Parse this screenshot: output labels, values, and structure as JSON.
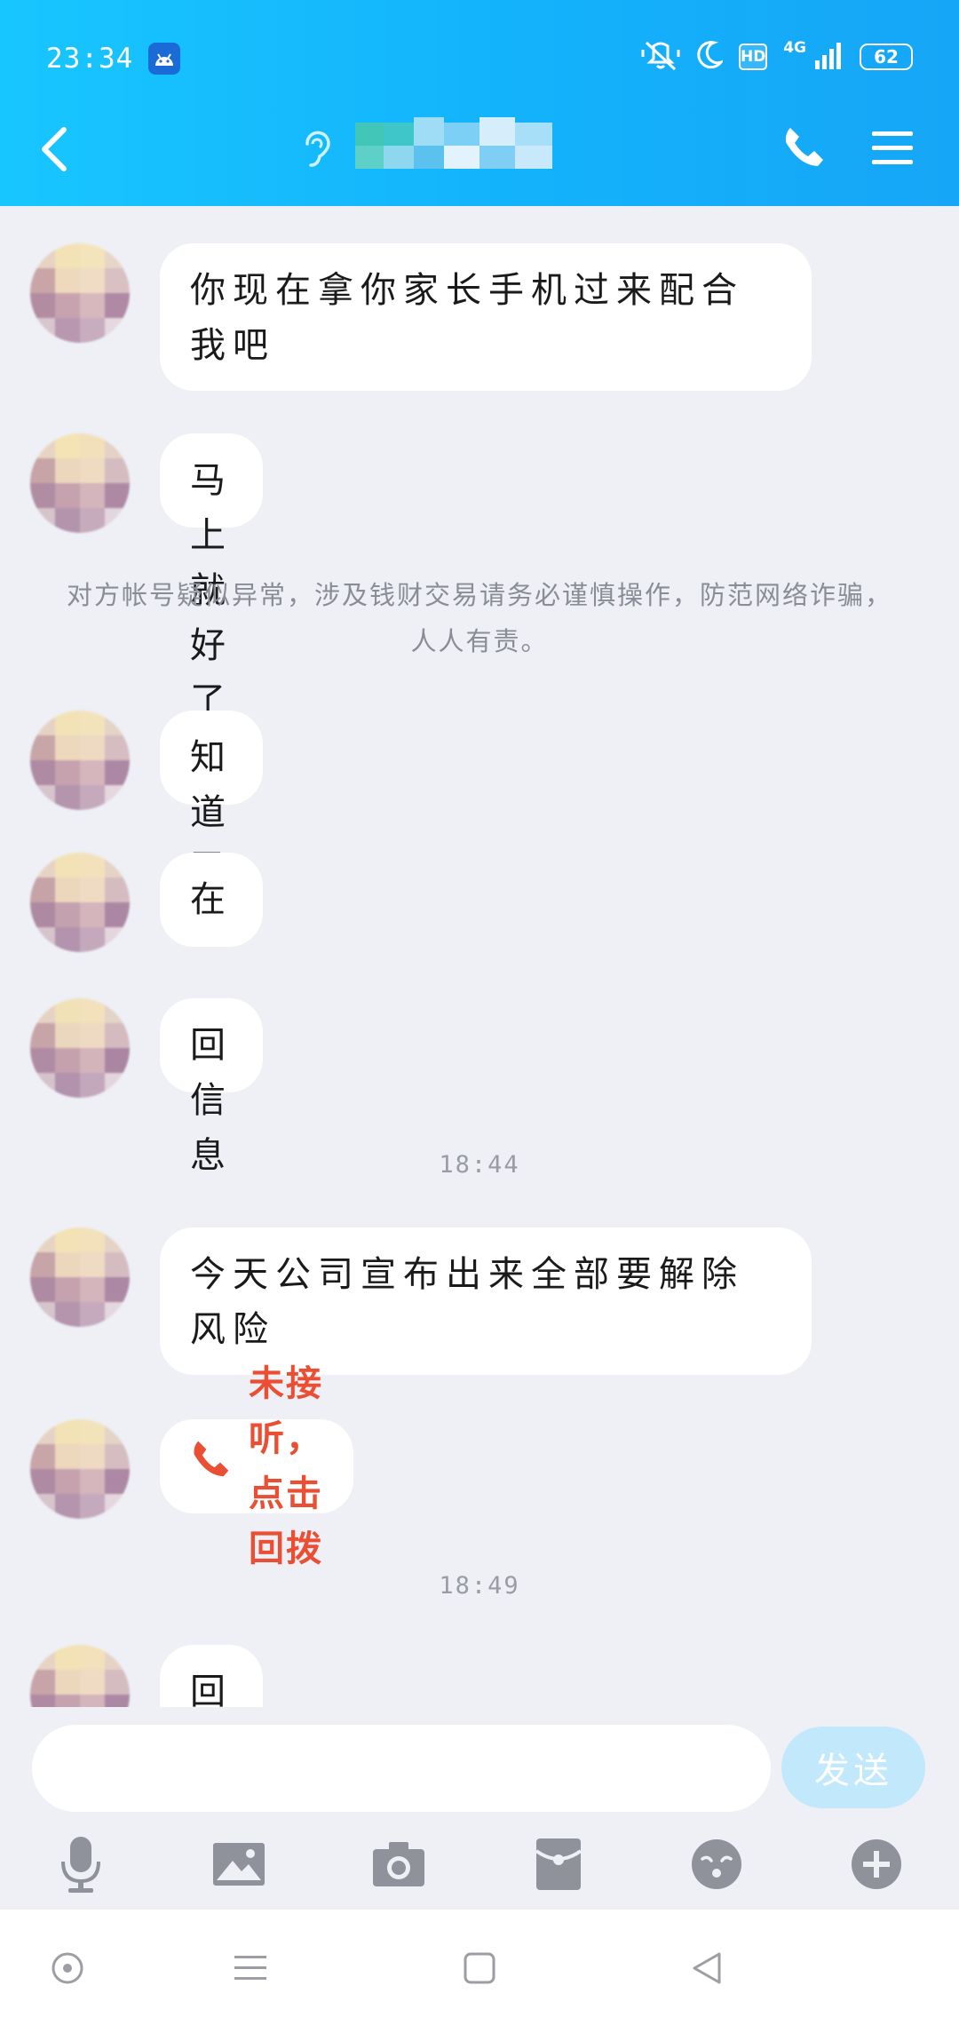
{
  "status_bar": {
    "time": "23:34",
    "network": "4G",
    "hd": "HD",
    "battery": "62"
  },
  "header": {
    "contact_name": ""
  },
  "messages": [
    {
      "type": "text",
      "text": "你现在拿你家长手机过来配合我吧"
    },
    {
      "type": "text",
      "text": "马上就好了"
    },
    {
      "type": "notice",
      "text": "对方帐号疑似异常，涉及钱财交易请务必谨慎操作，防范网络诈骗，人人有责。"
    },
    {
      "type": "text",
      "text": "知道了吗"
    },
    {
      "type": "text",
      "text": "在"
    },
    {
      "type": "text",
      "text": "回信息"
    },
    {
      "type": "time",
      "text": "18:44"
    },
    {
      "type": "text",
      "text": "今天公司宣布出来全部要解除风险"
    },
    {
      "type": "missed_call",
      "text": "未接听，点击回拨"
    },
    {
      "type": "time",
      "text": "18:49"
    },
    {
      "type": "text",
      "text": "回个信息"
    }
  ],
  "composer": {
    "input_value": "",
    "send_label": "发送"
  },
  "toolbar": {
    "icons": [
      "microphone-icon",
      "image-icon",
      "camera-icon",
      "red-packet-icon",
      "emoji-icon",
      "plus-icon"
    ]
  },
  "colors": {
    "header": "#13b2fb",
    "background": "#eef0f6",
    "bubble": "#ffffff",
    "missed_call": "#ea4e33",
    "send_button": "#c2e8fb"
  }
}
